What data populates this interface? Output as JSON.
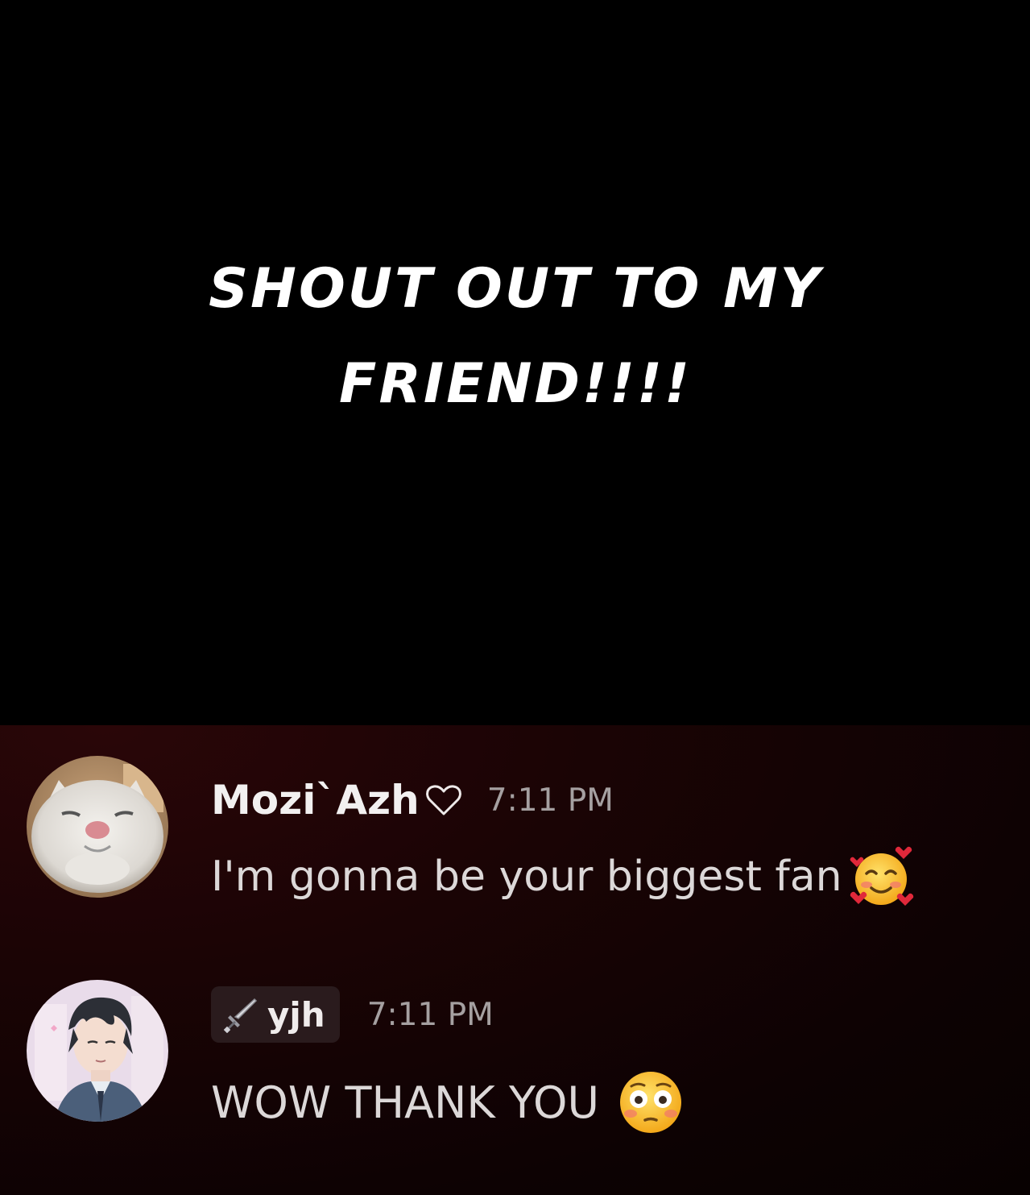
{
  "caption": {
    "text": "SHOUT OUT TO MY FRIEND!!!!"
  },
  "messages": [
    {
      "username": "Mozi`Azh",
      "username_icon": "heart-outline-icon",
      "timestamp": "7:11 PM",
      "text": "I'm gonna be your biggest fan",
      "emoji": "smiling-face-with-hearts",
      "avatar": "white-cat-avatar"
    },
    {
      "username": "yjh",
      "role_icon": "sword-icon",
      "timestamp": "7:11 PM",
      "text": "WOW THANK YOU",
      "emoji": "flushed-face",
      "avatar": "anime-boy-avatar"
    }
  ],
  "colors": {
    "caption_bg": "#000000",
    "chat_bg": "#1b0405",
    "username": "#f2f0f0",
    "timestamp": "#a5a0a1",
    "message_text": "#dcd8d8",
    "badge_bg": "#2a1b1d"
  }
}
